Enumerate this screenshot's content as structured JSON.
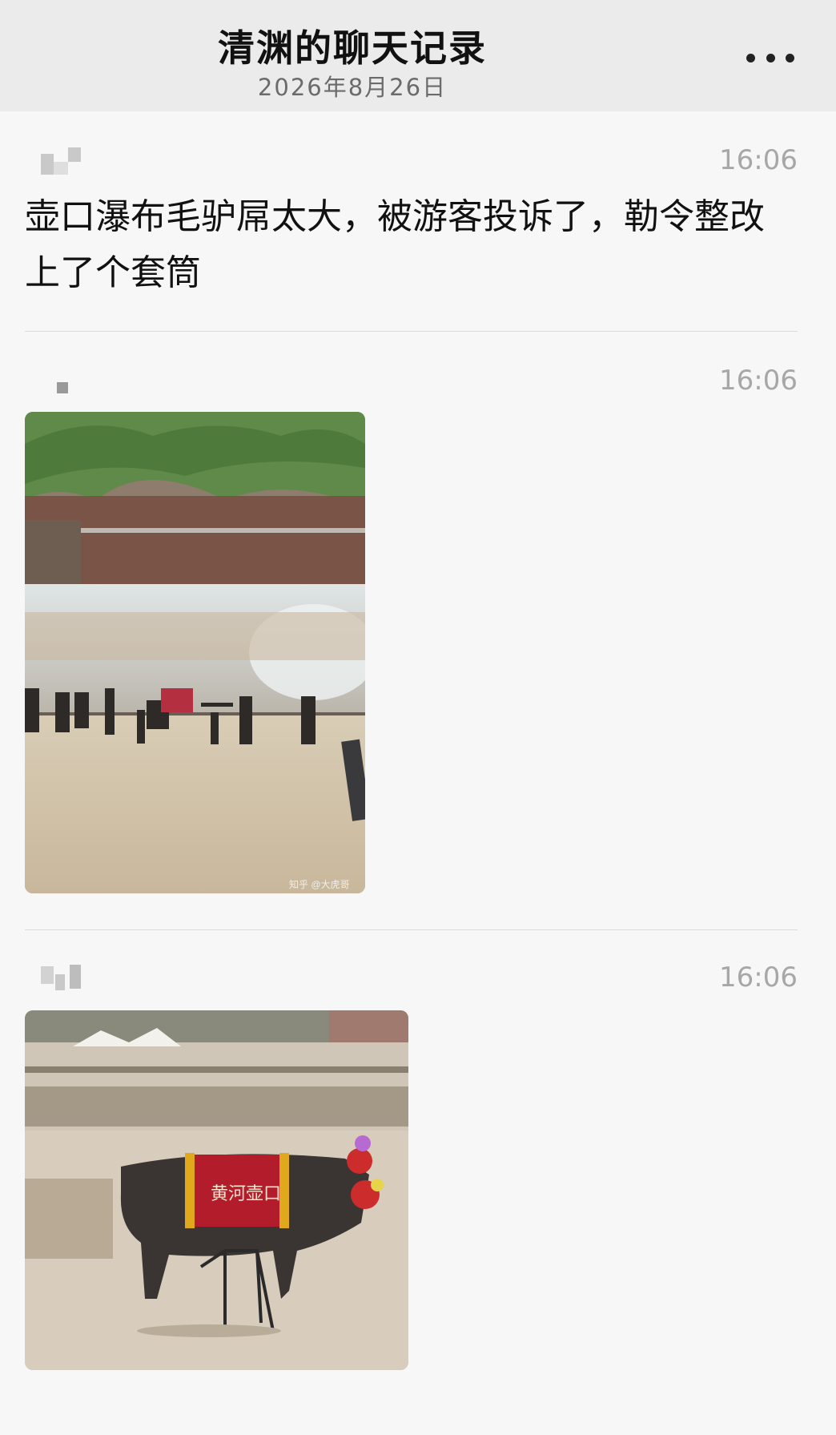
{
  "header": {
    "title": "清渊的聊天记录",
    "date": "2026年8月26日",
    "more_icon": "more-dots-icon"
  },
  "messages": [
    {
      "type": "text",
      "time": "16:06",
      "text": "壶口瀑布毛驴屌太大，被游客投诉了，勒令整改上了个套筒"
    },
    {
      "type": "image",
      "time": "16:06",
      "image_desc": "photo",
      "watermark": "知乎 @大虎哥"
    },
    {
      "type": "image",
      "time": "16:06",
      "image_desc": "photo",
      "saddle_text": "黄河壶口"
    }
  ]
}
